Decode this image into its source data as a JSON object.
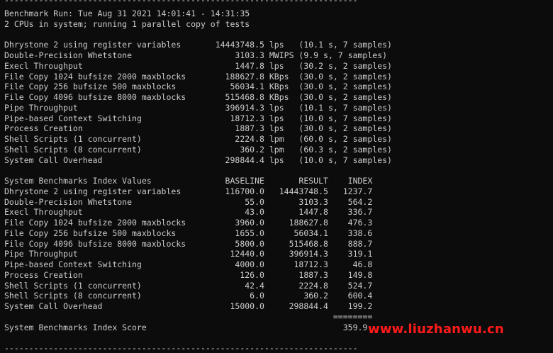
{
  "terminal": {
    "rule": "------------------------------------------------------------------------",
    "header": {
      "line1": "Benchmark Run: Tue Aug 31 2021 14:01:41 - 14:31:35",
      "line2": "2 CPUs in system; running 1 parallel copy of tests"
    },
    "results": [
      "Dhrystone 2 using register variables       14443748.5 lps   (10.1 s, 7 samples)",
      "Double-Precision Whetstone                     3103.3 MWIPS (9.9 s, 7 samples)",
      "Execl Throughput                               1447.8 lps   (30.2 s, 2 samples)",
      "File Copy 1024 bufsize 2000 maxblocks        188627.8 KBps  (30.0 s, 2 samples)",
      "File Copy 256 bufsize 500 maxblocks           56034.1 KBps  (30.0 s, 2 samples)",
      "File Copy 4096 bufsize 8000 maxblocks        515468.8 KBps  (30.0 s, 2 samples)",
      "Pipe Throughput                              396914.3 lps   (10.1 s, 7 samples)",
      "Pipe-based Context Switching                  18712.3 lps   (10.0 s, 7 samples)",
      "Process Creation                               1887.3 lps   (30.0 s, 2 samples)",
      "Shell Scripts (1 concurrent)                   2224.8 lpm   (60.0 s, 2 samples)",
      "Shell Scripts (8 concurrent)                    360.2 lpm   (60.3 s, 2 samples)",
      "System Call Overhead                         298844.4 lps   (10.0 s, 7 samples)"
    ],
    "index_header": "System Benchmarks Index Values               BASELINE       RESULT    INDEX",
    "index_rows": [
      "Dhrystone 2 using register variables         116700.0   14443748.5   1237.7",
      "Double-Precision Whetstone                       55.0       3103.3    564.2",
      "Execl Throughput                                 43.0       1447.8    336.7",
      "File Copy 1024 bufsize 2000 maxblocks          3960.0     188627.8    476.3",
      "File Copy 256 bufsize 500 maxblocks            1655.0      56034.1    338.6",
      "File Copy 4096 bufsize 8000 maxblocks          5800.0     515468.8    888.7",
      "Pipe Throughput                               12440.0     396914.3    319.1",
      "Pipe-based Context Switching                   4000.0      18712.3     46.8",
      "Process Creation                                126.0       1887.3    149.8",
      "Shell Scripts (1 concurrent)                     42.4       2224.8    524.7",
      "Shell Scripts (8 concurrent)                      6.0        360.2    600.4",
      "System Call Overhead                          15000.0     298844.4    199.2"
    ],
    "separator": "                                                                   ========",
    "score_line": "System Benchmarks Index Score                                        359.9"
  },
  "watermark": "www.liuzhanwu.cn",
  "colors": {
    "background": "#0c0c0c",
    "text": "#cccccc",
    "watermark": "#ff1a1a"
  }
}
